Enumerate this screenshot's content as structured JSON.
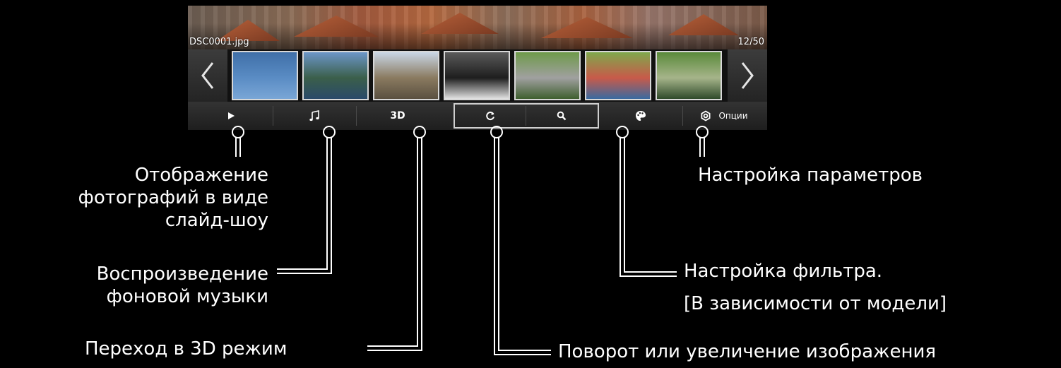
{
  "viewer": {
    "file_name": "DSC0001.jpg",
    "counter": "12/50",
    "nav_prev_glyph": "‹",
    "nav_next_glyph": "›",
    "thumbnails": [
      {
        "name": "thumbnail-sky",
        "colors": [
          "#3f6fa8",
          "#5a8cc4",
          "#7aa6d6"
        ]
      },
      {
        "name": "thumbnail-river",
        "colors": [
          "#6c96c8",
          "#3b5f4a",
          "#2a4a6a"
        ]
      },
      {
        "name": "thumbnail-cathedral",
        "colors": [
          "#c9d6e6",
          "#8a7a60",
          "#5a5040"
        ]
      },
      {
        "name": "thumbnail-gondolas",
        "colors": [
          "#5a5a5a",
          "#1e1e1e",
          "#e2e2e2"
        ]
      },
      {
        "name": "thumbnail-street",
        "colors": [
          "#6e9a4a",
          "#a0a0a0",
          "#3f5f2f"
        ]
      },
      {
        "name": "thumbnail-graffiti-wall",
        "colors": [
          "#7fa84c",
          "#c85a4a",
          "#3a6aa0"
        ]
      },
      {
        "name": "thumbnail-railway",
        "colors": [
          "#5a8a3a",
          "#a6b48a",
          "#2f4a2a"
        ]
      }
    ]
  },
  "toolbar": {
    "slideshow_icon": "play-icon",
    "music_icon": "music-note-icon",
    "mode3d_label": "3D",
    "rotate_icon": "rotate-icon",
    "zoom_icon": "magnifier-icon",
    "filter_icon": "palette-icon",
    "options_icon": "gear-icon",
    "options_label": "Опции"
  },
  "callouts": {
    "slideshow": [
      "Отображение",
      "фотографий в виде",
      "слайд-шоу"
    ],
    "music": [
      "Воспроизведение",
      "фоновой музыки"
    ],
    "mode3d": "Переход в 3D режим",
    "rotate_zoom": "Поворот или увеличение изображения",
    "filter": [
      "Настройка фильтра.",
      "[В зависимости от модели]"
    ],
    "options": "Настройка параметров"
  },
  "colors": {
    "background": "#000000",
    "text": "#ffffff",
    "connector": "#ffffff",
    "highlight_border": "#cfcfcf"
  }
}
